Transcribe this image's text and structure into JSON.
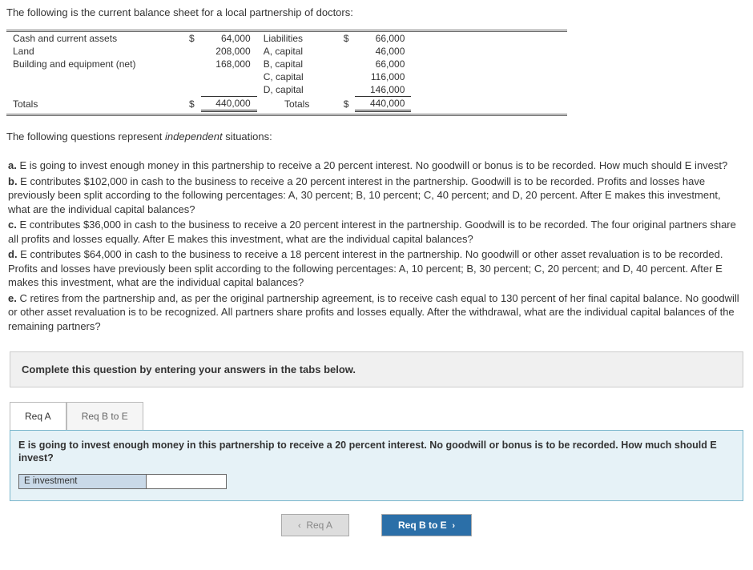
{
  "intro": "The following is the current balance sheet for a local partnership of doctors:",
  "bs": {
    "rows_left": [
      {
        "label": "Cash and current assets",
        "cur": "$",
        "amt": "64,000"
      },
      {
        "label": "Land",
        "cur": "",
        "amt": "208,000"
      },
      {
        "label": "Building and equipment (net)",
        "cur": "",
        "amt": "168,000"
      }
    ],
    "rows_right": [
      {
        "label": "Liabilities",
        "cur": "$",
        "amt": "66,000"
      },
      {
        "label": "A, capital",
        "cur": "",
        "amt": "46,000"
      },
      {
        "label": "B, capital",
        "cur": "",
        "amt": "66,000"
      },
      {
        "label": "C, capital",
        "cur": "",
        "amt": "116,000"
      },
      {
        "label": "D, capital",
        "cur": "",
        "amt": "146,000"
      }
    ],
    "totals_label": "Totals",
    "totals_left_cur": "$",
    "totals_left_amt": "440,000",
    "totals_right_cur": "$",
    "totals_right_amt": "440,000"
  },
  "section": {
    "pre": "The following questions represent ",
    "italic": "independent",
    "post": " situations:"
  },
  "questions": {
    "a": "E is going to invest enough money in this partnership to receive a 20 percent interest. No goodwill or bonus is to be recorded. How much should E invest?",
    "b": "E contributes $102,000 in cash to the business to receive a 20 percent interest in the partnership. Goodwill is to be recorded. Profits and losses have previously been split according to the following percentages: A, 30 percent; B, 10 percent; C, 40 percent; and D, 20 percent. After E makes this investment, what are the individual capital balances?",
    "c": "E contributes $36,000 in cash to the business to receive a 20 percent interest in the partnership. Goodwill is to be recorded. The four original partners share all profits and losses equally. After E makes this investment, what are the individual capital balances?",
    "d": "E contributes $64,000 in cash to the business to receive a 18 percent interest in the partnership. No goodwill or other asset revaluation is to be recorded. Profits and losses have previously been split according to the following percentages: A, 10 percent; B, 30 percent; C, 20 percent; and D, 40 percent. After E makes this investment, what are the individual capital balances?",
    "e": "C retires from the partnership and, as per the original partnership agreement, is to receive cash equal to 130 percent of her final capital balance. No goodwill or other asset revaluation is to be recognized. All partners share profits and losses equally. After the withdrawal, what are the individual capital balances of the remaining partners?"
  },
  "answer_instruction": "Complete this question by entering your answers in the tabs below.",
  "tabs": {
    "a": "Req A",
    "b": "Req B to E"
  },
  "panel": {
    "text": "E is going to invest enough money in this partnership to receive a 20 percent interest. No goodwill or bonus is to be recorded. How much should E invest?",
    "input_label": "E investment"
  },
  "nav": {
    "prev": "Req A",
    "next": "Req B to E"
  },
  "chart_data": {
    "type": "table",
    "title": "Partnership Balance Sheet",
    "assets": [
      {
        "item": "Cash and current assets",
        "amount": 64000
      },
      {
        "item": "Land",
        "amount": 208000
      },
      {
        "item": "Building and equipment (net)",
        "amount": 168000
      }
    ],
    "liabilities_equity": [
      {
        "item": "Liabilities",
        "amount": 66000
      },
      {
        "item": "A, capital",
        "amount": 46000
      },
      {
        "item": "B, capital",
        "amount": 66000
      },
      {
        "item": "C, capital",
        "amount": 116000
      },
      {
        "item": "D, capital",
        "amount": 146000
      }
    ],
    "totals": {
      "assets": 440000,
      "liabilities_equity": 440000
    }
  }
}
